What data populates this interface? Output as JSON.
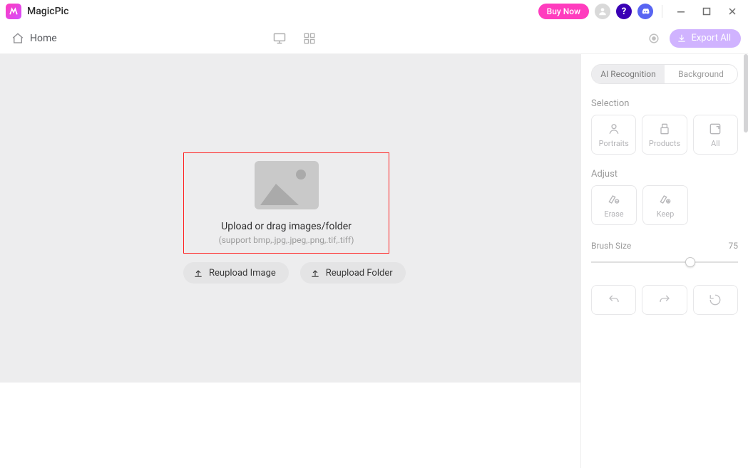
{
  "app": {
    "name": "MagicPic"
  },
  "titlebar": {
    "buy_now": "Buy Now"
  },
  "toolbar": {
    "home": "Home",
    "export_all": "Export All"
  },
  "dropzone": {
    "title": "Upload or drag images/folder",
    "subtitle": "(support bmp,.jpg,.jpeg,.png,.tif,.tiff)"
  },
  "reupload": {
    "image": "Reupload Image",
    "folder": "Reupload Folder"
  },
  "panel": {
    "tabs": {
      "ai": "AI Recognition",
      "bg": "Background"
    },
    "selection_label": "Selection",
    "selection": {
      "portraits": "Portraits",
      "products": "Products",
      "all": "All"
    },
    "adjust_label": "Adjust",
    "adjust": {
      "erase": "Erase",
      "keep": "Keep"
    },
    "brush_label": "Brush Size",
    "brush_value": "75"
  }
}
